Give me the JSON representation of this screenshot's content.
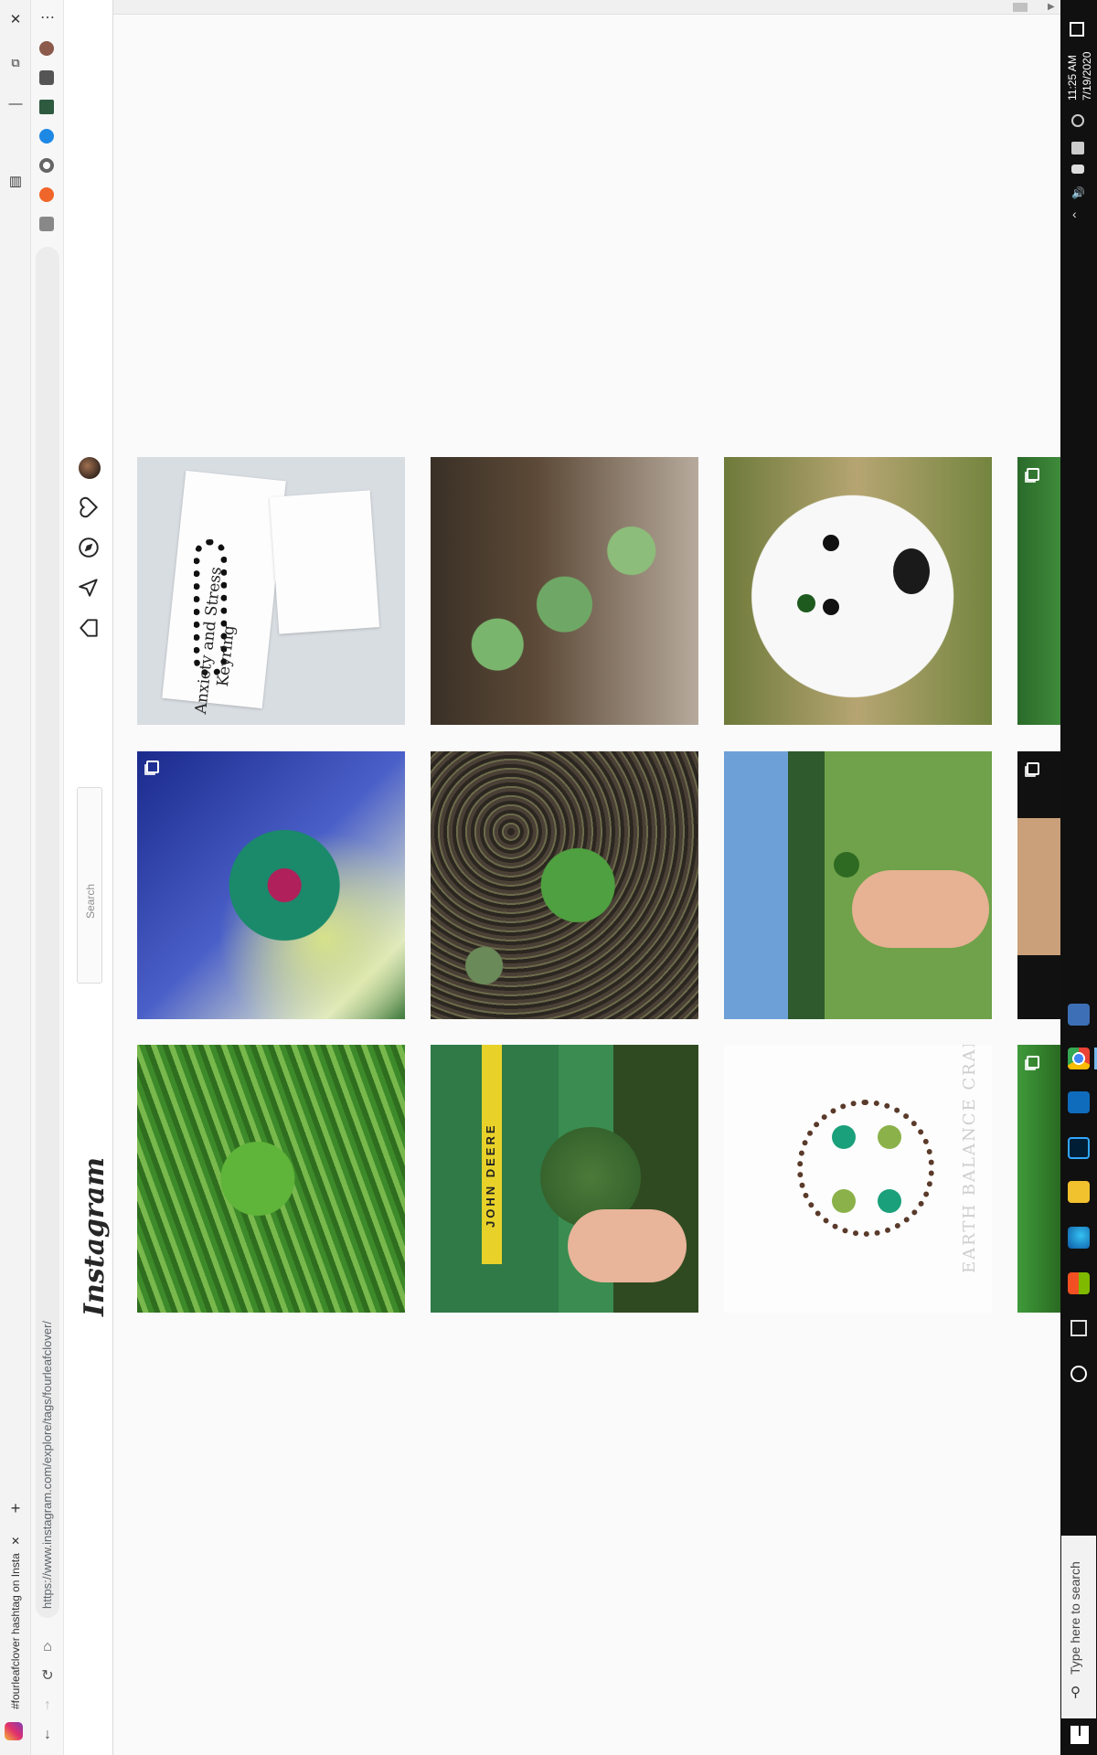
{
  "browser": {
    "tab_title": "#fourleafclover hashtag on Insta",
    "url": "https://www.instagram.com/explore/tags/fourleafclover/",
    "tab_close": "✕",
    "new_tab": "+",
    "menu": "⋯"
  },
  "instagram": {
    "logo": "Instagram",
    "search_placeholder": "Search"
  },
  "taskbar": {
    "time": "11:25 AM",
    "date": "7/19/2020",
    "search_placeholder": "Type here to search"
  },
  "images": {
    "tile1_text_a": "Anxiety and Stress",
    "tile1_text_b": "Keyring",
    "tile8_label": "JOHN DEERE",
    "tile9_label": "EARTH BALANCE CRAFT"
  },
  "colors": {
    "taskbar_bg": "#101010",
    "page_bg": "#fafafa"
  }
}
